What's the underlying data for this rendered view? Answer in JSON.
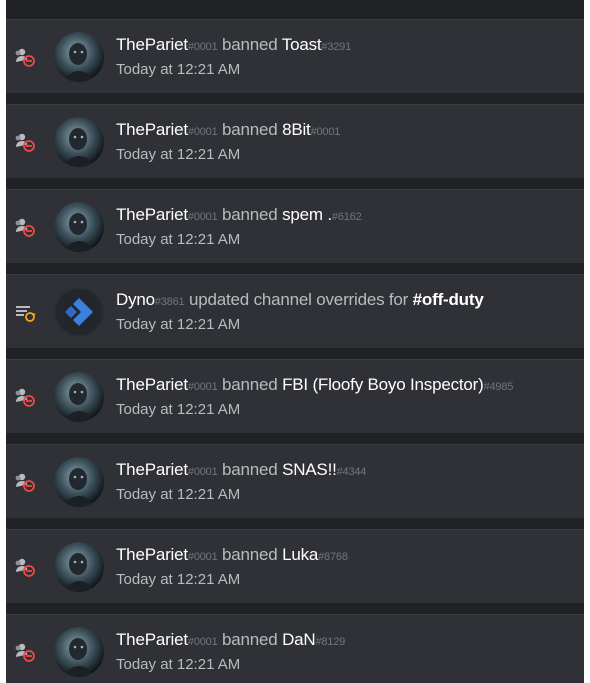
{
  "entries": [
    {
      "type": "ban",
      "user": "ThePariet",
      "user_disc": "#0001",
      "action": " banned ",
      "target": "Toast",
      "target_disc": "#3291",
      "time": "Today at 12:21 AM",
      "icon": "member-ban-icon"
    },
    {
      "type": "ban",
      "user": "ThePariet",
      "user_disc": "#0001",
      "action": " banned ",
      "target": "8Bit",
      "target_disc": "#0001",
      "time": "Today at 12:21 AM",
      "icon": "member-ban-icon"
    },
    {
      "type": "ban",
      "user": "ThePariet",
      "user_disc": "#0001",
      "action": " banned ",
      "target": "spem .",
      "target_disc": "#6162",
      "time": "Today at 12:21 AM",
      "icon": "member-ban-icon"
    },
    {
      "type": "channel",
      "user": "Dyno",
      "user_disc": "#3861",
      "action": " updated channel overrides for ",
      "target": "#off-duty",
      "time": "Today at 12:21 AM",
      "icon": "channel-update-icon"
    },
    {
      "type": "ban",
      "user": "ThePariet",
      "user_disc": "#0001",
      "action": " banned ",
      "target": "FBI (Floofy Boyo Inspector)",
      "target_disc": "#4985",
      "time": "Today at 12:21 AM",
      "icon": "member-ban-icon"
    },
    {
      "type": "ban",
      "user": "ThePariet",
      "user_disc": "#0001",
      "action": " banned ",
      "target": "SNAS!!",
      "target_disc": "#4344",
      "time": "Today at 12:21 AM",
      "icon": "member-ban-icon"
    },
    {
      "type": "ban",
      "user": "ThePariet",
      "user_disc": "#0001",
      "action": " banned ",
      "target": "Luka",
      "target_disc": "#8768",
      "time": "Today at 12:21 AM",
      "icon": "member-ban-icon"
    },
    {
      "type": "ban",
      "user": "ThePariet",
      "user_disc": "#0001",
      "action": " banned ",
      "target": "DaN",
      "target_disc": "#8129",
      "time": "Today at 12:21 AM",
      "icon": "member-ban-icon"
    }
  ],
  "colors": {
    "panel": "#2f3136",
    "ban_icon": "#f04747",
    "update_icon": "#faa61a",
    "dyno_avatar": "#3b7fe0"
  }
}
